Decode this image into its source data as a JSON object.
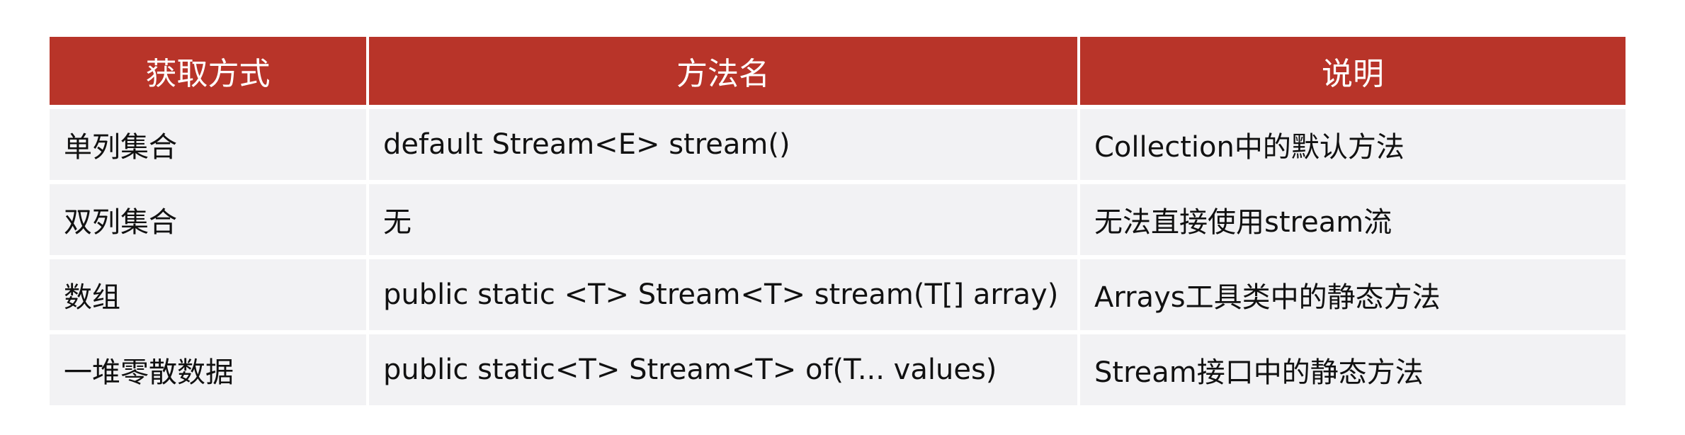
{
  "table": {
    "headers": [
      "获取方式",
      "方法名",
      "说明"
    ],
    "rows": [
      [
        "单列集合",
        "default Stream<E> stream()",
        "Collection中的默认方法"
      ],
      [
        "双列集合",
        "无",
        "无法直接使用stream流"
      ],
      [
        "数组",
        "public static <T> Stream<T> stream(T[] array)",
        "Arrays工具类中的静态方法"
      ],
      [
        "一堆零散数据",
        "public static<T> Stream<T> of(T... values)",
        "Stream接口中的静态方法"
      ]
    ]
  },
  "colors": {
    "header_bg": "#b83429",
    "header_text": "#ffffff",
    "row_bg": "#f2f2f4",
    "text": "#111111"
  }
}
